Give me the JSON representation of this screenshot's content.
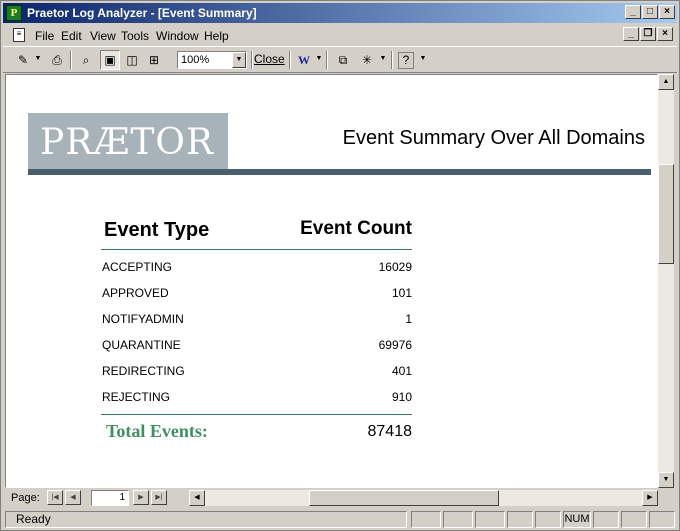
{
  "window": {
    "title": "Praetor Log Analyzer - [Event Summary]",
    "app_icon_glyph": "P"
  },
  "menu": {
    "items": [
      "File",
      "Edit",
      "View",
      "Tools",
      "Window",
      "Help"
    ]
  },
  "toolbar": {
    "zoom_value": "100%",
    "close_label": "Close",
    "help_glyph": "?"
  },
  "report": {
    "logo_text": "PRÆTOR",
    "title": "Event Summary Over All Domains",
    "col_type": "Event Type",
    "col_count": "Event Count",
    "rows": [
      {
        "type": "ACCEPTING",
        "count": "16029"
      },
      {
        "type": "APPROVED",
        "count": "101"
      },
      {
        "type": "NOTIFYADMIN",
        "count": "1"
      },
      {
        "type": "QUARANTINE",
        "count": "69976"
      },
      {
        "type": "REDIRECTING",
        "count": "401"
      },
      {
        "type": "REJECTING",
        "count": "910"
      }
    ],
    "total_label": "Total Events:",
    "total_value": "87418"
  },
  "navigator": {
    "page_label": "Page:",
    "page_value": "1"
  },
  "status": {
    "text": "Ready",
    "num_indicator": "NUM"
  },
  "colors": {
    "accent_green": "#3f8f5f",
    "logo_gray": "#a7b3b8",
    "header_bar": "#4a5f6e"
  }
}
